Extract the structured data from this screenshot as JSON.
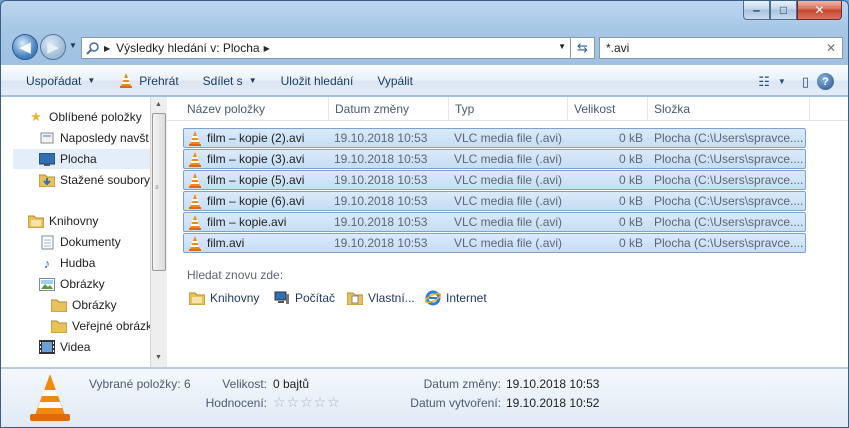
{
  "window": {
    "minimize": "‒",
    "maximize": "□",
    "close": "✕"
  },
  "address": {
    "crumb": "Výsledky hledání v: Plocha"
  },
  "search": {
    "value": "*.avi",
    "clear": "✕"
  },
  "toolbar": {
    "organize": "Uspořádat",
    "play": "Přehrát",
    "share": "Sdílet s",
    "save_search": "Uložit hledání",
    "burn": "Vypálit",
    "help": "?"
  },
  "nav": {
    "favorites": "Oblíbené položky",
    "recent": "Naposledy navšt",
    "desktop": "Plocha",
    "downloads": "Stažené soubory",
    "libraries": "Knihovny",
    "documents": "Dokumenty",
    "music": "Hudba",
    "pictures": "Obrázky",
    "pictures_sub": "Obrázky",
    "public_pictures": "Veřejné obrázky",
    "videos": "Videa"
  },
  "columns": {
    "name": "Název položky",
    "date": "Datum změny",
    "type": "Typ",
    "size": "Velikost",
    "folder": "Složka"
  },
  "files": [
    {
      "name": "film – kopie (2).avi",
      "date": "19.10.2018 10:53",
      "type": "VLC media file (.avi)",
      "size": "0 kB",
      "folder": "Plocha (C:\\Users\\spravce...."
    },
    {
      "name": "film – kopie (3).avi",
      "date": "19.10.2018 10:53",
      "type": "VLC media file (.avi)",
      "size": "0 kB",
      "folder": "Plocha (C:\\Users\\spravce...."
    },
    {
      "name": "film – kopie (5).avi",
      "date": "19.10.2018 10:53",
      "type": "VLC media file (.avi)",
      "size": "0 kB",
      "folder": "Plocha (C:\\Users\\spravce...."
    },
    {
      "name": "film – kopie (6).avi",
      "date": "19.10.2018 10:53",
      "type": "VLC media file (.avi)",
      "size": "0 kB",
      "folder": "Plocha (C:\\Users\\spravce...."
    },
    {
      "name": "film – kopie.avi",
      "date": "19.10.2018 10:53",
      "type": "VLC media file (.avi)",
      "size": "0 kB",
      "folder": "Plocha (C:\\Users\\spravce...."
    },
    {
      "name": "film.avi",
      "date": "19.10.2018 10:53",
      "type": "VLC media file (.avi)",
      "size": "0 kB",
      "folder": "Plocha (C:\\Users\\spravce...."
    }
  ],
  "search_again": {
    "label": "Hledat znovu zde:",
    "libraries": "Knihovny",
    "computer": "Počítač",
    "custom": "Vlastní...",
    "internet": "Internet"
  },
  "details": {
    "selected": "Vybrané položky: 6",
    "size_label": "Velikost:",
    "size_value": "0 bajtů",
    "rating_label": "Hodnocení:",
    "stars": "☆☆☆☆☆",
    "modified_label": "Datum změny:",
    "modified_value": "19.10.2018 10:53",
    "created_label": "Datum vytvoření:",
    "created_value": "19.10.2018 10:52"
  }
}
